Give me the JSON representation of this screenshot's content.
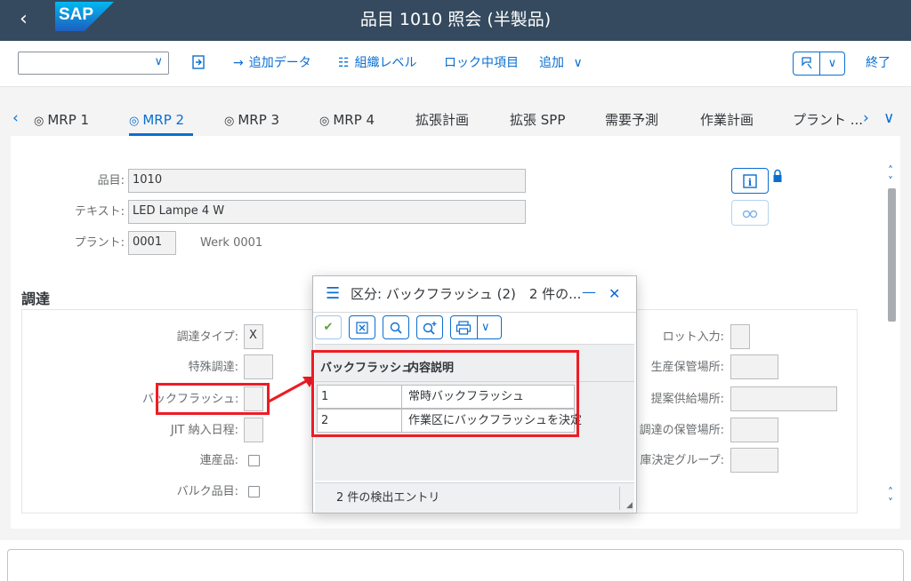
{
  "shell": {
    "title": "品目 1010 照会 (半製品)",
    "logo": "SAP",
    "back_icon": "chevron-left-icon"
  },
  "toolbar": {
    "select_value": "",
    "add_data": "追加データ",
    "org_levels": "組織レベル",
    "locked_items": "ロック中項目",
    "add": "追加",
    "end": "終了"
  },
  "tabs": {
    "items": [
      "MRP 1",
      "MRP 2",
      "MRP 3",
      "MRP 4",
      "拡張計画",
      "拡張 SPP",
      "需要予測",
      "作業計画",
      "プラント ..."
    ],
    "active": "MRP 2"
  },
  "header": {
    "material_label": "品目:",
    "material_value": "1010",
    "text_label": "テキスト:",
    "text_value": "LED Lampe 4 W",
    "plant_label": "プラント:",
    "plant_value": "0001",
    "plant_name": "Werk 0001"
  },
  "procurement": {
    "title": "調達",
    "procurement_type_label": "調達タイプ:",
    "procurement_type_value": "X",
    "special_procurement_label": "特殊調達:",
    "backflush_label": "バックフラッシュ:",
    "jit_label": "JIT 納入日程:",
    "coproduct_label": "連産品:",
    "bulk_label": "バルク品目:",
    "lot_input_label": "ロット入力:",
    "prod_storage_label": "生産保管場所:",
    "proposed_supply_label": "提案供給場所:",
    "proc_storage_label": "調達の保管場所:",
    "storage_group_label": "庫決定グループ:"
  },
  "dialog": {
    "title": "区分: バックフラッシュ (2)　2 件の...",
    "columns": [
      "バックフラッシュ",
      "内容説明"
    ],
    "rows": [
      {
        "key": "1",
        "desc": "常時バックフラッシュ"
      },
      {
        "key": "2",
        "desc": "作業区にバックフラッシュを決定"
      }
    ],
    "footer": "2 件の検出エントリ"
  },
  "colors": {
    "shell_bg": "#354a5f",
    "accent": "#0a6ed1",
    "annotation": "#ee1c25"
  }
}
